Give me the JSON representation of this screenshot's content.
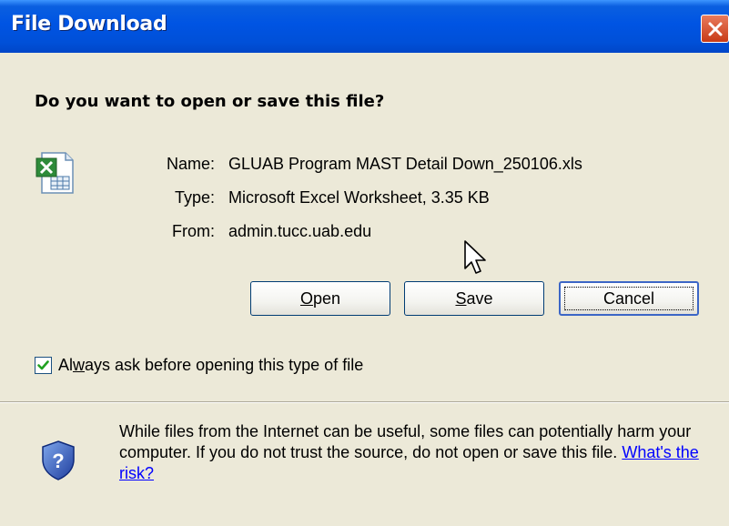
{
  "window": {
    "title": "File Download"
  },
  "prompt": {
    "question": "Do you want to open or save this file?"
  },
  "file": {
    "icon": "excel-worksheet-icon",
    "name_label": "Name:",
    "name_value": "GLUAB Program MAST Detail Down_250106.xls",
    "type_label": "Type:",
    "type_value": "Microsoft Excel Worksheet, 3.35 KB",
    "from_label": "From:",
    "from_value": "admin.tucc.uab.edu"
  },
  "buttons": {
    "open": {
      "accel": "O",
      "rest": "pen"
    },
    "save": {
      "accel": "S",
      "rest": "ave"
    },
    "cancel": "Cancel"
  },
  "checkbox": {
    "before": "Al",
    "accel": "w",
    "after": "ays ask before opening this type of file",
    "checked": true
  },
  "warning": {
    "text": "While files from the Internet can be useful, some files can potentially harm your computer. If you do not trust the source, do not open or save this file.",
    "link": "What's the risk?"
  },
  "colors": {
    "titlebar": "#0054e3",
    "dialog_bg": "#ece9d8",
    "link": "#0000ff",
    "close": "#c83b16"
  }
}
